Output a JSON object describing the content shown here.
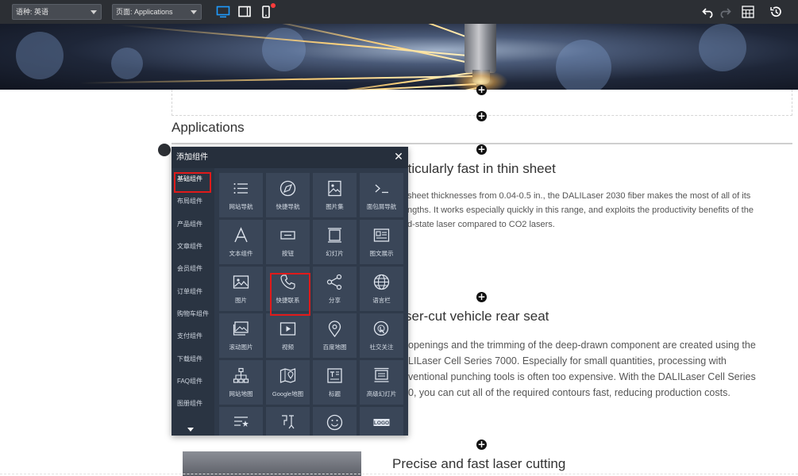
{
  "toolbar": {
    "language_select": "语种: 英语",
    "page_select": "页面: Applications",
    "icons": [
      "desktop-icon",
      "tablet-icon",
      "mobile-icon",
      "undo-icon",
      "redo-icon",
      "grid-icon",
      "history-icon"
    ]
  },
  "content": {
    "section_title": "Applications",
    "block1": {
      "heading": "rticularly fast in thin sheet",
      "lines": [
        "sheet thicknesses from 0.04-0.5 in., the DALILaser 2030 fiber makes the most of all of its",
        "ngths. It works especially quickly in this range, and exploits the productivity benefits of the",
        "d-state laser compared to CO2 lasers."
      ]
    },
    "block2": {
      "heading": "ser-cut vehicle rear seat",
      "lines": [
        "openings and the trimming of the deep-drawn component are created using the",
        "LILaser Cell Series 7000. Especially for small quantities, processing with",
        "ventional punching tools is often too expensive. With the DALILaser Cell Series",
        "0, you can cut all of the required contours fast, reducing production costs."
      ]
    },
    "block3": {
      "heading": "Precise and fast laser cutting"
    }
  },
  "panel": {
    "title": "添加组件",
    "categories": [
      "基础组件",
      "布局组件",
      "产品组件",
      "文章组件",
      "会员组件",
      "订单组件",
      "购物车组件",
      "支付组件",
      "下载组件",
      "FAQ组件",
      "图册组件"
    ],
    "active_category": "基础组件",
    "widgets": [
      {
        "label": "网站导航",
        "icon": "list-icon"
      },
      {
        "label": "快捷导航",
        "icon": "compass-icon"
      },
      {
        "label": "图片集",
        "icon": "gallery-icon"
      },
      {
        "label": "面包屑导航",
        "icon": "breadcrumb-icon"
      },
      {
        "label": "文本组件",
        "icon": "text-icon"
      },
      {
        "label": "按钮",
        "icon": "button-icon"
      },
      {
        "label": "幻灯片",
        "icon": "slideshow-icon"
      },
      {
        "label": "图文展示",
        "icon": "image-text-icon"
      },
      {
        "label": "图片",
        "icon": "image-icon"
      },
      {
        "label": "快捷联系",
        "icon": "phone-icon"
      },
      {
        "label": "分享",
        "icon": "share-icon"
      },
      {
        "label": "语言栏",
        "icon": "globe-icon"
      },
      {
        "label": "滚动图片",
        "icon": "scroll-image-icon"
      },
      {
        "label": "视频",
        "icon": "video-icon"
      },
      {
        "label": "百度地图",
        "icon": "map-pin-icon"
      },
      {
        "label": "社交关注",
        "icon": "social-icon"
      },
      {
        "label": "网站地图",
        "icon": "sitemap-icon"
      },
      {
        "label": "Google地图",
        "icon": "google-map-icon"
      },
      {
        "label": "标题",
        "icon": "title-icon"
      },
      {
        "label": "高级幻灯片",
        "icon": "advanced-slideshow-icon"
      },
      {
        "label": "",
        "icon": "rating-list-icon"
      },
      {
        "label": "",
        "icon": "code-icon"
      },
      {
        "label": "",
        "icon": "emoji-icon"
      },
      {
        "label": "",
        "icon": "logo-icon"
      }
    ],
    "logo_text": "LOGO"
  },
  "colors": {
    "toolbar_bg": "#2c2f34",
    "panel_bg": "#2f3a4a",
    "cell_bg": "#3a4658",
    "highlight": "#e01a1a",
    "accent_blue": "#1e9bff"
  }
}
